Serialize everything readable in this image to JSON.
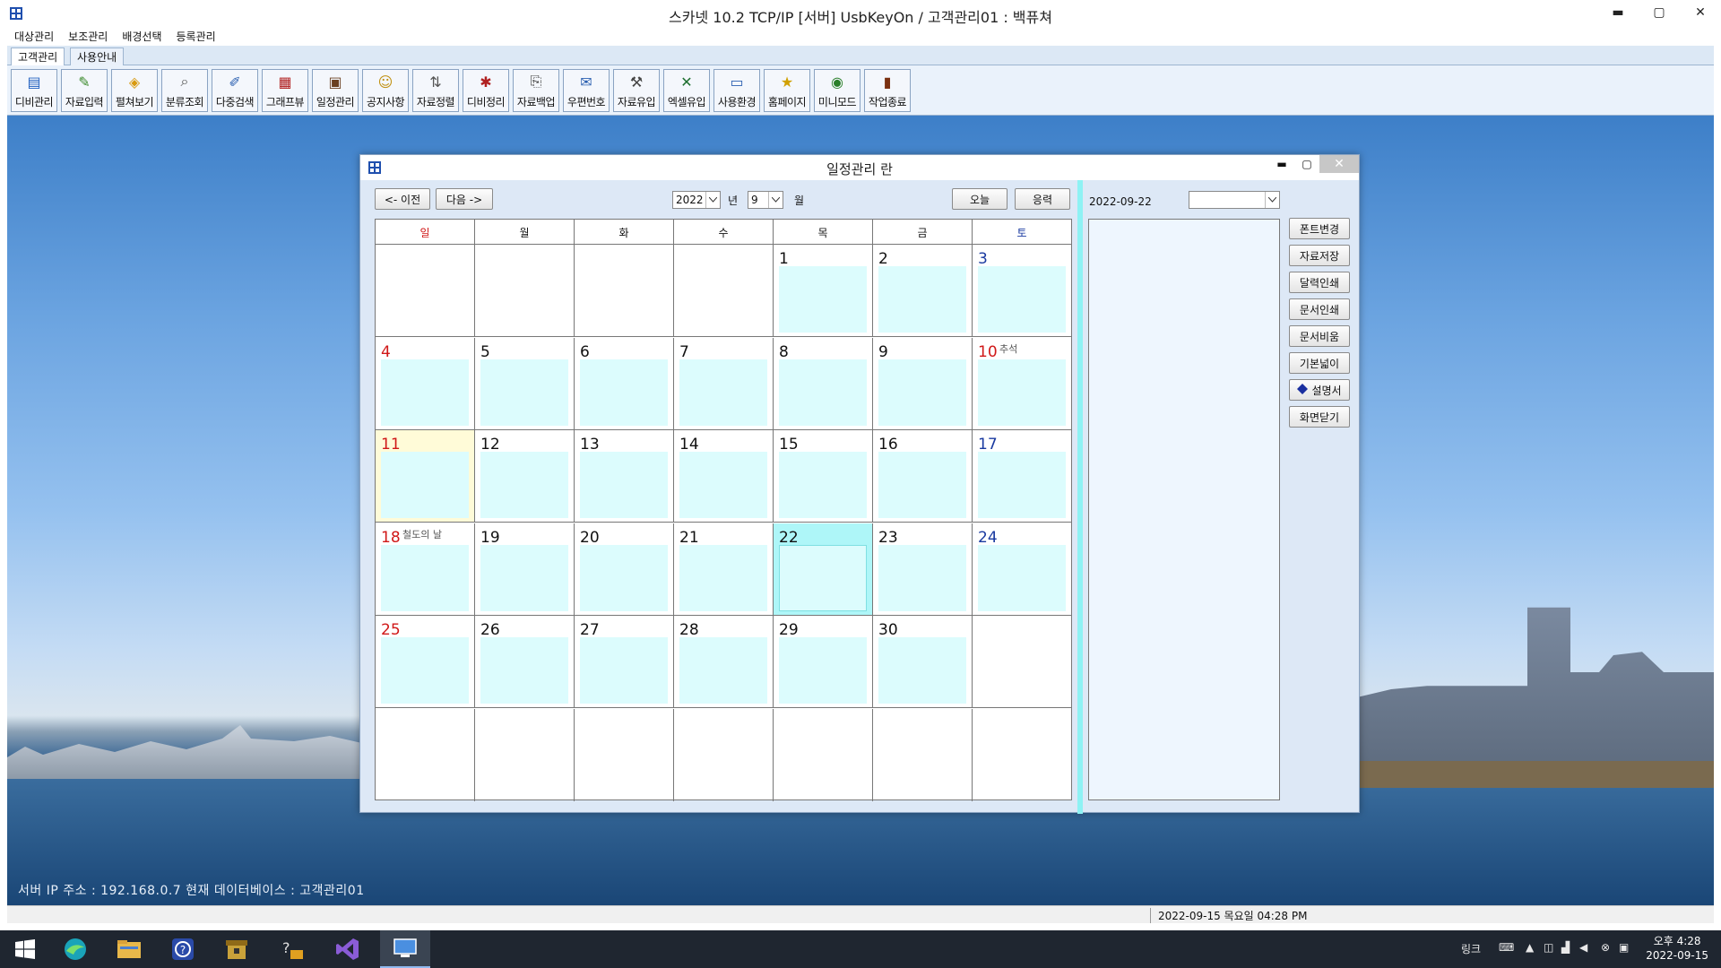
{
  "app": {
    "title": "스카넷 10.2 TCP/IP [서버] UsbKeyOn / 고객관리01 : 백퓨쳐",
    "minimize": "▬",
    "maximize": "▢",
    "close": "✕"
  },
  "menu": [
    "대상관리",
    "보조관리",
    "배경선택",
    "등록관리"
  ],
  "tabs": [
    "고객관리",
    "사용안내"
  ],
  "toolbar": [
    {
      "label": "디비관리",
      "icon": "db-manage-icon",
      "glyph": "▤",
      "color": "#1f5fbf"
    },
    {
      "label": "자료입력",
      "icon": "data-input-icon",
      "glyph": "✎",
      "color": "#3a8a2a"
    },
    {
      "label": "펼쳐보기",
      "icon": "expand-view-icon",
      "glyph": "◈",
      "color": "#d89a10"
    },
    {
      "label": "분류조회",
      "icon": "category-search-icon",
      "glyph": "⌕",
      "color": "#555"
    },
    {
      "label": "다중검색",
      "icon": "multi-search-icon",
      "glyph": "✐",
      "color": "#2a5fb0"
    },
    {
      "label": "그래프뷰",
      "icon": "graph-view-icon",
      "glyph": "▦",
      "color": "#b02020"
    },
    {
      "label": "일정관리",
      "icon": "schedule-icon",
      "glyph": "▣",
      "color": "#6a4020"
    },
    {
      "label": "공지사항",
      "icon": "notice-icon",
      "glyph": "☺",
      "color": "#c09010"
    },
    {
      "label": "자료정렬",
      "icon": "data-sort-icon",
      "glyph": "⇅",
      "color": "#555"
    },
    {
      "label": "디비정리",
      "icon": "db-clean-icon",
      "glyph": "✱",
      "color": "#b02020"
    },
    {
      "label": "자료백업",
      "icon": "data-backup-icon",
      "glyph": "⎘",
      "color": "#444"
    },
    {
      "label": "우편번호",
      "icon": "postcode-icon",
      "glyph": "✉",
      "color": "#2a5fb0"
    },
    {
      "label": "자료유입",
      "icon": "data-import-icon",
      "glyph": "⚒",
      "color": "#444"
    },
    {
      "label": "엑셀유입",
      "icon": "excel-import-icon",
      "glyph": "✕",
      "color": "#1f6f30"
    },
    {
      "label": "사용환경",
      "icon": "settings-icon",
      "glyph": "▭",
      "color": "#2a5fb0"
    },
    {
      "label": "홈페이지",
      "icon": "homepage-icon",
      "glyph": "★",
      "color": "#d0a000"
    },
    {
      "label": "미니모드",
      "icon": "mini-mode-icon",
      "glyph": "◉",
      "color": "#2a7f2a"
    },
    {
      "label": "작업종료",
      "icon": "exit-icon",
      "glyph": "▮",
      "color": "#7a3010"
    }
  ],
  "desktop": {
    "server_info": "서버 IP 주소 : 192.168.0.7   현재 데이터베이스 : 고객관리01"
  },
  "status": {
    "datetime": "2022-09-15 목요일 04:28 PM"
  },
  "taskbar": {
    "apps": [
      "windows-start-icon",
      "browser-icon",
      "file-explorer-icon",
      "help-icon",
      "box-app-icon",
      "support-app-icon",
      "visual-studio-icon",
      "scanet-app-icon"
    ],
    "tray_link": "링크",
    "time": "오후 4:28",
    "date": "2022-09-15"
  },
  "dialog": {
    "title": "일정관리 란",
    "prev_button": "<- 이전",
    "next_button": "다음 ->",
    "year": "2022",
    "year_label": "년",
    "month": "9",
    "month_label": "월",
    "today_button": "오늘",
    "apply_button": "응력",
    "selected_date": "2022-09-22",
    "side_combo": "",
    "weekdays": [
      "일",
      "월",
      "화",
      "수",
      "목",
      "금",
      "토"
    ],
    "weeks": [
      [
        {
          "day": "",
          "holiday": ""
        },
        {
          "day": "",
          "holiday": ""
        },
        {
          "day": "",
          "holiday": ""
        },
        {
          "day": "",
          "holiday": ""
        },
        {
          "day": "1",
          "holiday": ""
        },
        {
          "day": "2",
          "holiday": ""
        },
        {
          "day": "3",
          "holiday": ""
        }
      ],
      [
        {
          "day": "4",
          "holiday": ""
        },
        {
          "day": "5",
          "holiday": ""
        },
        {
          "day": "6",
          "holiday": ""
        },
        {
          "day": "7",
          "holiday": ""
        },
        {
          "day": "8",
          "holiday": ""
        },
        {
          "day": "9",
          "holiday": ""
        },
        {
          "day": "10",
          "holiday": "추석"
        }
      ],
      [
        {
          "day": "11",
          "holiday": ""
        },
        {
          "day": "12",
          "holiday": ""
        },
        {
          "day": "13",
          "holiday": ""
        },
        {
          "day": "14",
          "holiday": ""
        },
        {
          "day": "15",
          "holiday": ""
        },
        {
          "day": "16",
          "holiday": ""
        },
        {
          "day": "17",
          "holiday": ""
        }
      ],
      [
        {
          "day": "18",
          "holiday": "철도의 날"
        },
        {
          "day": "19",
          "holiday": ""
        },
        {
          "day": "20",
          "holiday": ""
        },
        {
          "day": "21",
          "holiday": ""
        },
        {
          "day": "22",
          "holiday": ""
        },
        {
          "day": "23",
          "holiday": ""
        },
        {
          "day": "24",
          "holiday": ""
        }
      ],
      [
        {
          "day": "25",
          "holiday": ""
        },
        {
          "day": "26",
          "holiday": ""
        },
        {
          "day": "27",
          "holiday": ""
        },
        {
          "day": "28",
          "holiday": ""
        },
        {
          "day": "29",
          "holiday": ""
        },
        {
          "day": "30",
          "holiday": ""
        },
        {
          "day": "",
          "holiday": ""
        }
      ],
      [
        {
          "day": "",
          "holiday": ""
        },
        {
          "day": "",
          "holiday": ""
        },
        {
          "day": "",
          "holiday": ""
        },
        {
          "day": "",
          "holiday": ""
        },
        {
          "day": "",
          "holiday": ""
        },
        {
          "day": "",
          "holiday": ""
        },
        {
          "day": "",
          "holiday": ""
        }
      ]
    ],
    "highlight_day": "11",
    "selected_day": "22",
    "side_buttons": [
      "폰트변경",
      "자료저장",
      "달력인쇄",
      "문서인쇄",
      "문서비움",
      "기본넓이",
      "설명서",
      "화면닫기"
    ],
    "colors": {
      "sunday": "#d01818",
      "saturday": "#1a3aa0",
      "note_bg": "#dcfcfd",
      "selected_bg": "#aef6f8",
      "highlight_bg": "#fffbd8"
    }
  }
}
